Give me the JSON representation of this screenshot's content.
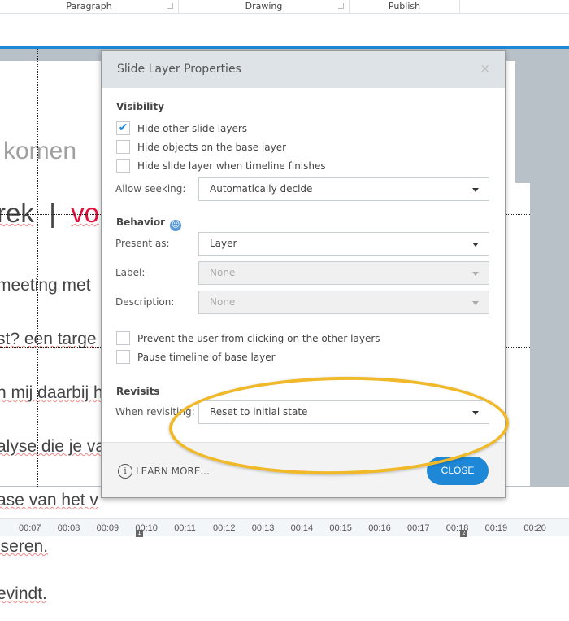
{
  "ribbon": {
    "groups": [
      "Paragraph",
      "Drawing",
      "Publish"
    ]
  },
  "slide": {
    "heading_partial": "komen",
    "title_partial_1": "rek",
    "title_separator": "|",
    "title_partial_2": "vo",
    "paragraph_lines": [
      "meeting met",
      "st? een targe",
      "n mij daarbij h",
      "alyse die je va",
      "ase van het v",
      "lseren.",
      "evindt."
    ]
  },
  "timeline": {
    "ticks": [
      "00:07",
      "00:08",
      "00:09",
      "00:10",
      "00:11",
      "00:12",
      "00:13",
      "00:14",
      "00:15",
      "00:16",
      "00:17",
      "00:18",
      "00:19",
      "00:20"
    ],
    "markers": [
      "1",
      "2"
    ]
  },
  "dialog": {
    "title": "Slide Layer Properties",
    "close_icon": "×",
    "visibility": {
      "heading": "Visibility",
      "checkboxes": [
        {
          "label": "Hide other slide layers",
          "checked": true
        },
        {
          "label": "Hide objects on the base layer",
          "checked": false
        },
        {
          "label": "Hide slide layer when timeline finishes",
          "checked": false
        }
      ],
      "allow_seeking_label": "Allow seeking:",
      "allow_seeking_value": "Automatically decide"
    },
    "behavior": {
      "heading": "Behavior",
      "present_as_label": "Present as:",
      "present_as_value": "Layer",
      "label_label": "Label:",
      "label_value": "None",
      "description_label": "Description:",
      "description_value": "None",
      "checkboxes": [
        {
          "label": "Prevent the user from clicking on the other layers",
          "checked": false
        },
        {
          "label": "Pause timeline of base layer",
          "checked": false
        }
      ]
    },
    "revisits": {
      "heading": "Revisits",
      "when_revisiting_label": "When revisiting:",
      "when_revisiting_value": "Reset to initial state"
    },
    "learn_more": "LEARN MORE...",
    "close_button": "CLOSE"
  },
  "colors": {
    "accent": "#1e87d6",
    "highlight": "#f0b92a",
    "title_red": "#e0103c"
  }
}
